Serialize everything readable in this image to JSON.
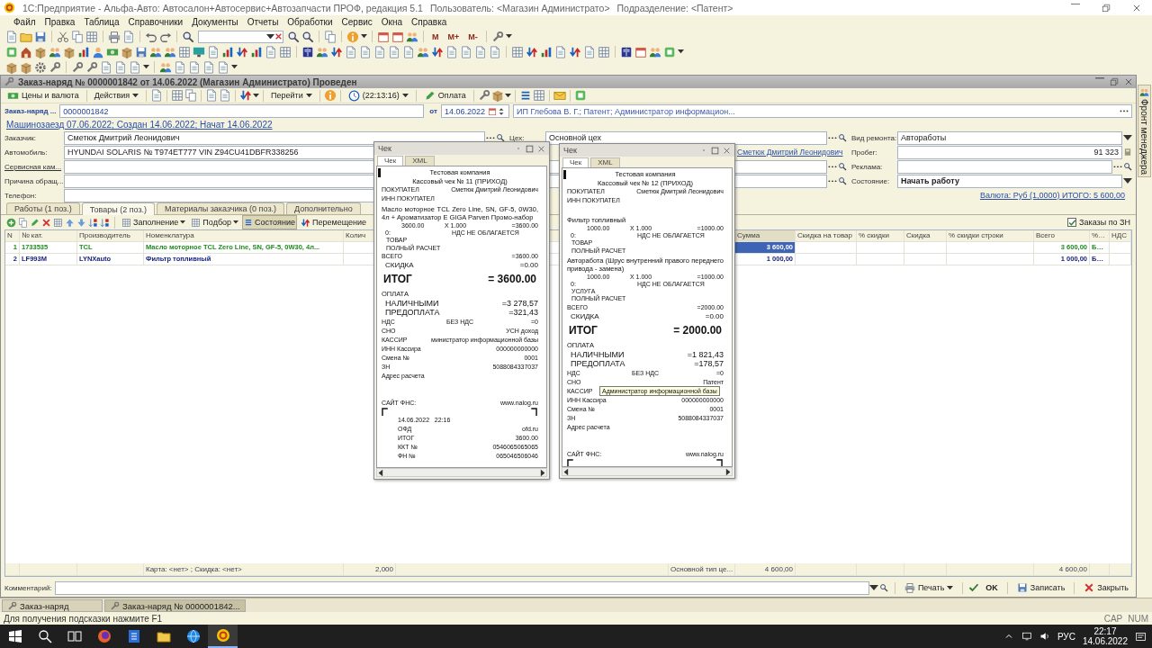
{
  "app": {
    "title": "1С:Предприятие - Альфа-Авто: Автосалон+Автосервис+Автозапчасти ПРОФ, редакция 5.1",
    "user": "Пользователь: <Магазин Администрато>",
    "division": "Подразделение: <Патент>"
  },
  "menu": [
    "Файл",
    "Правка",
    "Таблица",
    "Справочники",
    "Документы",
    "Отчеты",
    "Обработки",
    "Сервис",
    "Окна",
    "Справка"
  ],
  "toolbar_text_buttons": [
    "M",
    "M+",
    "M-"
  ],
  "document": {
    "title": "Заказ-наряд № 0000001842 от 14.06.2022 (Магазин Администрато) Проведен",
    "toolbar": {
      "prices": "Цены и валюта",
      "actions": "Действия",
      "go_to": "Перейти",
      "time": "(22:13:16)",
      "payment": "Оплата"
    },
    "number_label": "Заказ-наряд ...",
    "number": "0000001842",
    "date_label": "от",
    "date": "14.06.2022",
    "organization": "ИП Глебова В. Г.; Патент; Администратор информацион...",
    "history_link": "Машинозаезд 07.06.2022; Создан 14.06.2022; Начат 14.06.2022",
    "fields": [
      {
        "label": "Заказчик:",
        "value": "Сметюк Дмитрий Леонидович",
        "kind": "plain"
      },
      {
        "label": "Автомобиль:",
        "value": "HYUNDAI SOLARIS № T974ET777 VIN Z94CU41DBFR338256",
        "kind": "plain"
      },
      {
        "label": "Сервисная кам...",
        "kind": "link"
      },
      {
        "label": "Причина обращ...",
        "kind": "plain"
      },
      {
        "label": "Телефон:",
        "kind": "plain"
      }
    ],
    "workshop": {
      "label": "Цех:",
      "value": "Основной цех"
    },
    "contact_link": "Сметюк Дмитрий Леонидович",
    "right_fields": [
      {
        "label": "Вид ремонта:",
        "value": "Автоработы",
        "kind": "dropdown"
      },
      {
        "label": "Пробег:",
        "value": "91 323",
        "kind": "number"
      },
      {
        "label": "Реклама:",
        "kind": "choice"
      },
      {
        "label": "Состояние:",
        "value": "Начать работу",
        "kind": "dropdown"
      }
    ],
    "currency_link": "Валюта: Руб (1,0000) ИТОГО: 5 600,00",
    "tabs": [
      {
        "label": "Работы (1 поз.)",
        "selected": false
      },
      {
        "label": "Товары (2 поз.)",
        "selected": true
      },
      {
        "label": "Материалы заказчика (0 поз.)",
        "selected": false
      },
      {
        "label": "Дополнительно",
        "selected": false
      }
    ],
    "tab_toolbar": [
      {
        "label": "Заполнение",
        "kind": "menu",
        "pressed": false
      },
      {
        "label": "Подбор",
        "kind": "menu",
        "pressed": false
      },
      {
        "label": "Состояние",
        "kind": "toggle",
        "pressed": true
      },
      {
        "label": "Перемещение",
        "kind": "plain",
        "pressed": false
      }
    ],
    "orders_checkbox": {
      "label": "Заказы по ЗН",
      "checked": true
    },
    "table": {
      "columns": [
        "N",
        "№ кат.",
        "Производитель",
        "Номенклатура",
        "Колич",
        "Сумма",
        "Скидка на товар",
        "% скидки",
        "Скидка",
        "% скидки строки",
        "Всего",
        "%…",
        "НДС"
      ],
      "rows": [
        {
          "n": "1",
          "catalog_no": "1733535",
          "maker": "TCL",
          "item": "Масло моторное TCL Zero Line, SN, GF-5, 0W30, 4л...",
          "sum": "3 600,00",
          "total": "3 600,00",
          "vat_rate": "Б…",
          "color": "#1e8c1e",
          "selected": true
        },
        {
          "n": "2",
          "catalog_no": "LF993M",
          "maker": "LYNXauto",
          "item": "Фильтр топливный",
          "sum": "1 000,00",
          "total": "1 000,00",
          "vat_rate": "Б…",
          "color": "#1a237e",
          "selected": false
        }
      ],
      "footer": {
        "card": "Карта: <нет> ; Скидка: <нет>",
        "quantity": "2,000",
        "price_type": "Основной тип це...",
        "sum": "4 600,00",
        "total": "4 600,00"
      }
    },
    "comment_label": "Комментарий:",
    "buttons": {
      "print": "Печать",
      "ok": "OK",
      "save": "Записать",
      "close": "Закрыть"
    }
  },
  "side_panel": "Фронт менеджера",
  "receipts": [
    {
      "title": "Чек",
      "tabs": [
        {
          "label": "Чек",
          "selected": true
        },
        {
          "label": "XML",
          "selected": false
        }
      ],
      "lines": [
        {
          "kind": "center",
          "cells": [
            "Тестовая компания"
          ]
        },
        {
          "kind": "center",
          "cells": [
            "Кассовый чек № 11 (ПРИХОД)"
          ]
        },
        {
          "kind": "small",
          "cells": [
            "ПОКУПАТЕЛ",
            "Сметюк Дмитрий Леонидович"
          ]
        },
        {
          "kind": "small",
          "cells": [
            "ИНН ПОКУПАТЕЛ"
          ]
        },
        {
          "kind": "para",
          "cells": [
            "Масло моторное TCL Zero Line, SN, GF-5, 0W30, 4л + Ароматизатор E GIGA Parven Промо-набор"
          ]
        },
        {
          "kind": "qty",
          "cells": [
            "3600.00",
            "X  1.000",
            "=3600.00"
          ]
        },
        {
          "kind": "vat",
          "cells": [
            "0:",
            "НДС НЕ ОБЛАГАЕТСЯ"
          ]
        },
        {
          "kind": "sub",
          "cells": [
            "ТОВАР"
          ]
        },
        {
          "kind": "sub",
          "cells": [
            "ПОЛНЫЙ РАСЧЕТ"
          ]
        },
        {
          "kind": "row",
          "cells": [
            "ВСЕГО",
            "=3600.00"
          ]
        },
        {
          "kind": "sum",
          "cells": [
            "СКИДКА",
            "=0.00"
          ]
        },
        {
          "kind": "total",
          "cells": [
            "ИТОГ",
            "= 3600.00"
          ]
        },
        {
          "kind": "head",
          "cells": [
            "ОПЛАТА"
          ]
        },
        {
          "kind": "pay",
          "cells": [
            "НАЛИЧНЫМИ",
            "=3 278,57"
          ]
        },
        {
          "kind": "pay",
          "cells": [
            "ПРЕДОПЛАТА",
            "=321,43"
          ]
        },
        {
          "kind": "triple",
          "cells": [
            "НДС",
            "БЕЗ НДС",
            "=0"
          ]
        },
        {
          "kind": "row",
          "cells": [
            "СНО",
            "УСН доход"
          ]
        },
        {
          "kind": "row",
          "cells": [
            "КАССИР",
            "министратор информационной базы"
          ]
        },
        {
          "kind": "row",
          "cells": [
            "ИНН Кассира",
            "000000000000"
          ]
        },
        {
          "kind": "row",
          "cells": [
            "Смена №",
            "0001"
          ]
        },
        {
          "kind": "row",
          "cells": [
            "ЗН",
            "5088084337037"
          ]
        },
        {
          "kind": "row",
          "cells": [
            "Адрес расчета"
          ]
        },
        {
          "kind": "gap"
        },
        {
          "kind": "gap"
        },
        {
          "kind": "row",
          "cells": [
            "САЙТ ФНС:",
            "www.nalog.ru"
          ]
        },
        {
          "kind": "corners"
        },
        {
          "kind": "fiscal",
          "cells": [
            "14.06.2022   22:16"
          ]
        },
        {
          "kind": "fiscal",
          "cells": [
            "ОФД",
            "ofd.ru"
          ]
        },
        {
          "kind": "fiscal",
          "cells": [
            "ИТОГ",
            "3600.00"
          ]
        },
        {
          "kind": "fiscal",
          "cells": [
            "ККТ №",
            "0546065065065"
          ]
        },
        {
          "kind": "fiscal",
          "cells": [
            "ФН №",
            "065046506046"
          ]
        }
      ]
    },
    {
      "title": "Чек",
      "tabs": [
        {
          "label": "Чек",
          "selected": true
        },
        {
          "label": "XML",
          "selected": false
        }
      ],
      "lines": [
        {
          "kind": "center",
          "cells": [
            "Тестовая компания"
          ]
        },
        {
          "kind": "center",
          "cells": [
            "Кассовый чек № 12 (ПРИХОД)"
          ]
        },
        {
          "kind": "small",
          "cells": [
            "ПОКУПАТЕЛ",
            "Сметюк Дмитрий Леонидович"
          ]
        },
        {
          "kind": "small",
          "cells": [
            "ИНН ПОКУПАТЕЛ"
          ]
        },
        {
          "kind": "gap"
        },
        {
          "kind": "para",
          "cells": [
            "Фильтр топливный"
          ]
        },
        {
          "kind": "qty",
          "cells": [
            "1000.00",
            "X  1.000",
            "=1000.00"
          ]
        },
        {
          "kind": "vat",
          "cells": [
            "0:",
            "НДС НЕ ОБЛАГАЕТСЯ"
          ]
        },
        {
          "kind": "sub",
          "cells": [
            "ТОВАР"
          ]
        },
        {
          "kind": "sub",
          "cells": [
            "ПОЛНЫЙ РАСЧЕТ"
          ]
        },
        {
          "kind": "para",
          "cells": [
            "Авторабота (Шрус внутренний правого переднего привода - замена)"
          ]
        },
        {
          "kind": "qty",
          "cells": [
            "1000.00",
            "X  1.000",
            "=1000.00"
          ]
        },
        {
          "kind": "vat",
          "cells": [
            "0:",
            "НДС НЕ ОБЛАГАЕТСЯ"
          ]
        },
        {
          "kind": "sub",
          "cells": [
            "УСЛУГА"
          ]
        },
        {
          "kind": "sub",
          "cells": [
            "ПОЛНЫЙ РАСЧЕТ"
          ]
        },
        {
          "kind": "row",
          "cells": [
            "ВСЕГО",
            "=2000.00"
          ]
        },
        {
          "kind": "sum",
          "cells": [
            "СКИДКА",
            "=0.00"
          ]
        },
        {
          "kind": "total",
          "cells": [
            "ИТОГ",
            "= 2000.00"
          ]
        },
        {
          "kind": "head",
          "cells": [
            "ОПЛАТА"
          ]
        },
        {
          "kind": "pay",
          "cells": [
            "НАЛИЧНЫМИ",
            "=1 821,43"
          ]
        },
        {
          "kind": "pay",
          "cells": [
            "ПРЕДОПЛАТА",
            "=178,57"
          ]
        },
        {
          "kind": "triple",
          "cells": [
            "НДС",
            "БЕЗ НДС",
            "=0"
          ]
        },
        {
          "kind": "row",
          "cells": [
            "СНО",
            "Патент"
          ]
        },
        {
          "kind": "row",
          "cells": [
            "КАССИР"
          ],
          "tooltip": "Администратор информационной базы"
        },
        {
          "kind": "row",
          "cells": [
            "ИНН Кассира",
            "000000000000"
          ]
        },
        {
          "kind": "row",
          "cells": [
            "Смена №",
            "0001"
          ]
        },
        {
          "kind": "row",
          "cells": [
            "ЗН",
            "5088084337037"
          ]
        },
        {
          "kind": "row",
          "cells": [
            "Адрес расчета"
          ]
        },
        {
          "kind": "gap"
        },
        {
          "kind": "gap"
        },
        {
          "kind": "row",
          "cells": [
            "САЙТ ФНС:",
            "www.nalog.ru"
          ]
        },
        {
          "kind": "corners"
        }
      ]
    }
  ],
  "window_tabs": [
    {
      "label": "Заказ-наряд",
      "selected": false
    },
    {
      "label": "Заказ-наряд № 0000001842...",
      "selected": true
    }
  ],
  "status_bar": {
    "hint": "Для получения подсказки нажмите F1",
    "indicators": [
      "CAP",
      "NUM"
    ]
  },
  "taskbar": {
    "language": "РУС",
    "time": "22:17",
    "date": "14.06.2022"
  }
}
